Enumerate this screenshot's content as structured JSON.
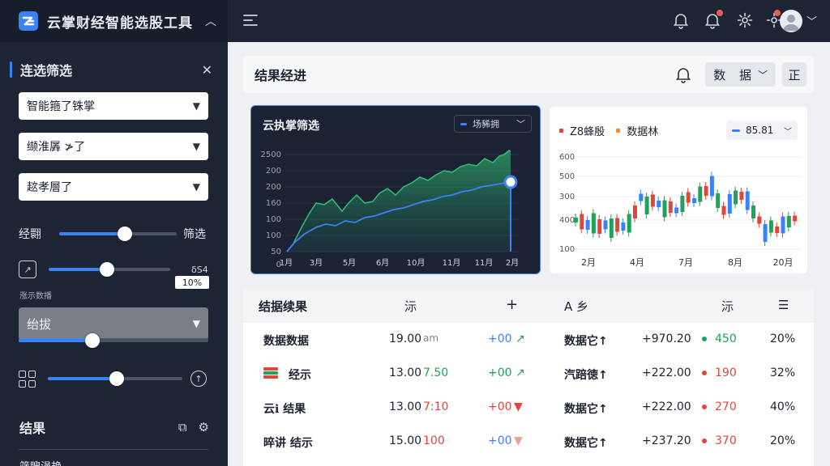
{
  "app": {
    "title": "云掌财经智能选股工具"
  },
  "sidebar": {
    "section_title": "连选筛选",
    "selects": [
      "智能箍了铢掌",
      "缬淮羼 ≯了",
      "趑孝層了"
    ],
    "slider1": {
      "left_label": "经翾",
      "right_label": "筛选",
      "value": 0.45
    },
    "slider2": {
      "right_label": "δS4",
      "value": 0.48,
      "badge": "10%"
    },
    "tiny_label": "涨示数播",
    "grey_select": {
      "value": "绐拔",
      "slider_value": 0.4
    },
    "slider3": {
      "value": 0.5
    },
    "results_title": "结果",
    "cut_label": "筛瞍浥艳"
  },
  "main": {
    "header_title": "结果经进",
    "btn_data": "数 据",
    "btn_zheng": "正"
  },
  "dark_chart": {
    "title": "云执掌筛选",
    "pill_label": "场豨拥",
    "y_ticks": [
      "2500",
      "200",
      "200",
      "160",
      "100",
      "100",
      "50",
      "0"
    ],
    "x_ticks": [
      "1月",
      "3月",
      "5月",
      "6月",
      "10月",
      "11月",
      "11月",
      "2月"
    ]
  },
  "light_chart": {
    "legend1": "Z8蜂殷",
    "legend2": "数据林",
    "pill_label": "85.81",
    "y_ticks": [
      "600",
      "500",
      "300",
      "400",
      "100"
    ],
    "x_ticks": [
      "2月",
      "4月",
      "7月",
      "8月",
      "20月"
    ]
  },
  "table": {
    "headers": [
      "结据续果",
      "沶",
      "+",
      "A 乡",
      "沶",
      "☰"
    ],
    "rows": [
      {
        "name": "数据数据",
        "price": "19.00",
        "sub": "am",
        "chg": "+00",
        "arrow": "↗",
        "tag": "数据它↑",
        "amount": "+970.20",
        "vol": "450",
        "pct": "20%",
        "dot_color": "#1fa35b",
        "price_sub_color": "#7e8697",
        "chg_color": "#3b82f6"
      },
      {
        "name": "经示",
        "price": "13.00",
        "sub": "7.50",
        "chg": "+00",
        "arrow": "↗",
        "tag": "汽踣徳↑",
        "amount": "+222.00",
        "vol": "190",
        "pct": "32%",
        "dot_color": "#e0473a",
        "price_sub_color": "#1fa35b",
        "chg_color": "#1fa35b"
      },
      {
        "name": "云ℹ 结果",
        "price": "13.00",
        "sub": "7:10",
        "chg": "+00",
        "arrow": "▼",
        "tag": "数据它↑",
        "amount": "+222.00",
        "vol": "270",
        "pct": "40%",
        "dot_color": "#e0473a",
        "price_sub_color": "#e0473a",
        "chg_color": "#e0473a"
      },
      {
        "name": "晬讲 结示",
        "price": "15.00",
        "sub": "100",
        "chg": "+00",
        "arrow": "▼",
        "tag": "数据它↑",
        "amount": "+237.20",
        "vol": "370",
        "pct": "20%",
        "dot_color": "#e0473a",
        "price_sub_color": "#e0473a",
        "chg_color": "#3b82f6"
      }
    ]
  },
  "colors": {
    "accent": "#3b82f6",
    "sidebar_bg": "#1d2433",
    "green": "#1fa35b",
    "red": "#e0473a"
  }
}
